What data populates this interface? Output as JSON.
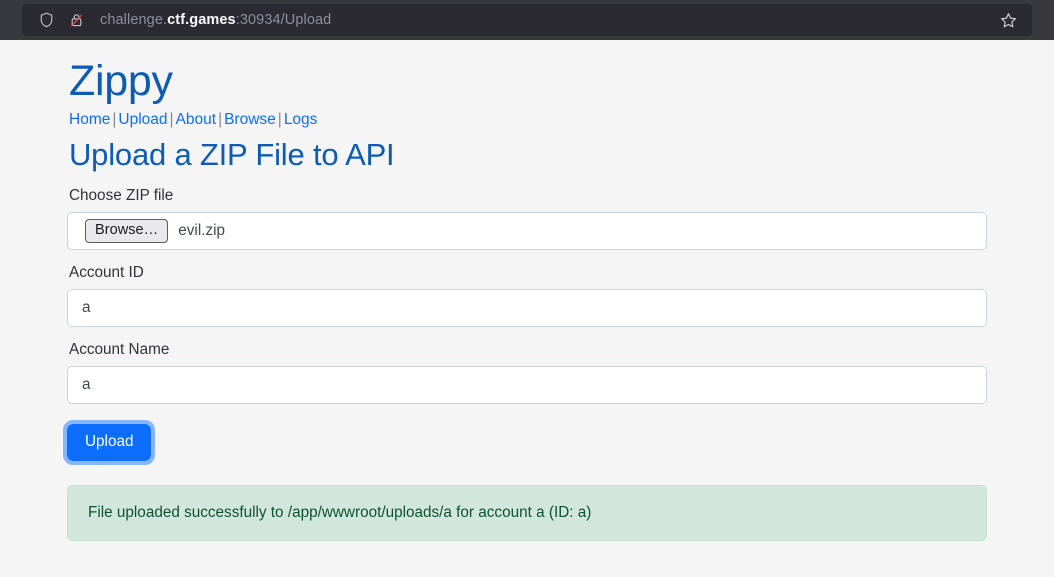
{
  "browser": {
    "url_prefix": "challenge.",
    "url_host": "ctf.games",
    "url_suffix": ":30934/Upload",
    "shield_icon": "shield-icon",
    "lock_icon": "lock-crossed-icon",
    "bookmark_icon": "star-icon",
    "chrome_bg": "#38383f",
    "urlbar_bg": "#2b2a33"
  },
  "site": {
    "brand": "Zippy",
    "nav": [
      {
        "label": "Home"
      },
      {
        "label": "Upload"
      },
      {
        "label": "About"
      },
      {
        "label": "Browse"
      },
      {
        "label": "Logs"
      }
    ],
    "separator": "|",
    "page_title": "Upload a ZIP File to API",
    "link_color": "#0d6efd",
    "heading_color": "#0d5bb5"
  },
  "form": {
    "file_label": "Choose ZIP file",
    "browse_button": "Browse…",
    "file_name": "evil.zip",
    "account_id_label": "Account ID",
    "account_id_value": "a",
    "account_name_label": "Account Name",
    "account_name_value": "a",
    "submit_label": "Upload",
    "submit_color": "#0d6efd",
    "focus_ring_color": "#86b7fe"
  },
  "alert": {
    "message": "File uploaded successfully to /app/wwwroot/uploads/a for account a (ID: a)",
    "bg": "#d1e7dd",
    "text_color": "#0f5132"
  }
}
